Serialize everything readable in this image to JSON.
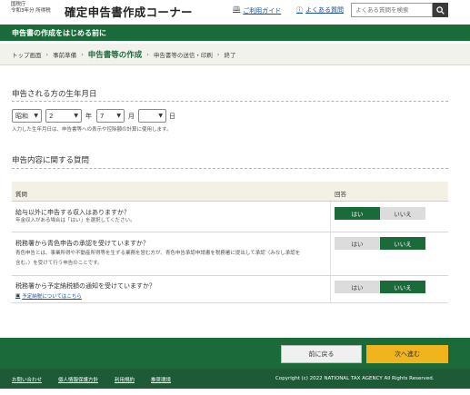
{
  "header": {
    "agency_line1": "国税庁",
    "agency_line2": "令和3年分 所得税",
    "title": "確定申告書作成コーナー",
    "guide_link": "ご利用ガイド",
    "faq_link": "よくある質問",
    "search_placeholder": "よくある質問を検索"
  },
  "banner": {
    "text": "申告書の作成をはじめる前に"
  },
  "breadcrumb": {
    "items": [
      "トップ画面",
      "事前準備",
      "申告書等の作成",
      "申告書等の送信・印刷",
      "終了"
    ],
    "current_index": 2
  },
  "birth": {
    "section_title": "申告される方の生年月日",
    "era_value": "昭和",
    "year_value": "2",
    "year_unit": "年",
    "month_value": "7",
    "month_unit": "月",
    "day_value": "",
    "day_unit": "日",
    "note": "入力した生年月日は、申告書等への表示や控除額の計算に使用します。"
  },
  "questions": {
    "section_title": "申告内容に関する質問",
    "col_question": "質問",
    "col_answer": "回答",
    "yes_label": "はい",
    "no_label": "いいえ",
    "rows": [
      {
        "question": "給与以外に申告する収入はありますか？",
        "sub": "年金収入がある場合は「はい」を選択してください。",
        "answer": "yes"
      },
      {
        "question": "税務署から青色申告の承認を受けていますか？",
        "sub_line1": "青色申告とは、事業所得や不動産所得等を生ずる業務を営む方が、青色申告承認申請書を税務署に提出して承認（みなし承認を",
        "sub_line2": "含む。）を受けて行う申告のことです。",
        "answer": "no"
      },
      {
        "question": "税務署から予定納税額の通知を受けていますか？",
        "link": "予定納税についてはこちら",
        "answer": "no"
      }
    ]
  },
  "nav": {
    "back_label": "前に戻る",
    "next_label": "次へ進む"
  },
  "footer": {
    "links": [
      "お問い合わせ",
      "個人情報保護方針",
      "利用規約",
      "推奨環境"
    ],
    "copyright": "Copyright (c) 2022 NATIONAL TAX AGENCY All Rights Reserved."
  },
  "colors": {
    "brand_green": "#1b6b3a",
    "accent_yellow": "#f0b51c"
  }
}
